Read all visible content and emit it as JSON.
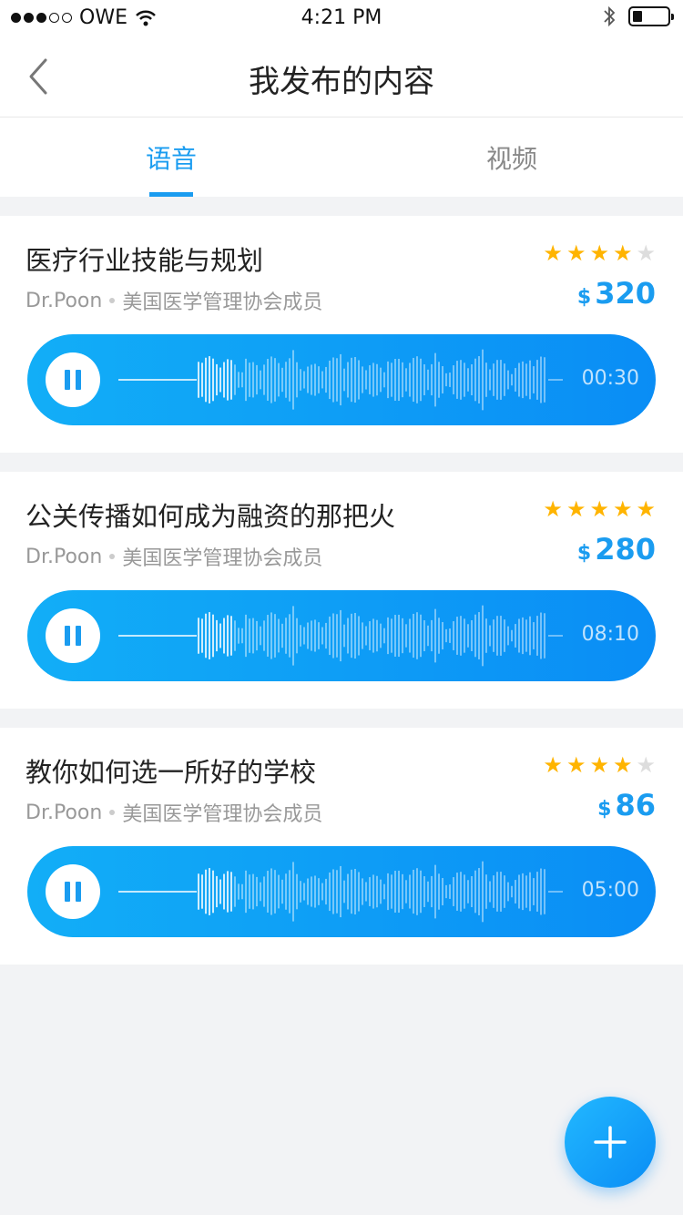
{
  "status_bar": {
    "carrier": "OWE",
    "time": "4:21 PM"
  },
  "header": {
    "title": "我发布的内容"
  },
  "tabs": [
    {
      "label": "语音",
      "active": true
    },
    {
      "label": "视频",
      "active": false
    }
  ],
  "items": [
    {
      "title": "医疗行业技能与规划",
      "author": "Dr.Poon",
      "org": "美国医学管理协会成员",
      "rating": 4,
      "max_rating": 5,
      "currency": "$",
      "price": "320",
      "duration": "00:30"
    },
    {
      "title": "公关传播如何成为融资的那把火",
      "author": "Dr.Poon",
      "org": "美国医学管理协会成员",
      "rating": 5,
      "max_rating": 5,
      "currency": "$",
      "price": "280",
      "duration": "08:10"
    },
    {
      "title": "教你如何选一所好的学校",
      "author": "Dr.Poon",
      "org": "美国医学管理协会成员",
      "rating": 4,
      "max_rating": 5,
      "currency": "$",
      "price": "86",
      "duration": "05:00"
    }
  ],
  "colors": {
    "accent": "#1a9cf0",
    "star": "#ffb400",
    "star_off": "#dddddd",
    "background": "#f2f3f5"
  },
  "icons": {
    "back": "chevron-left-icon",
    "pause": "pause-icon",
    "add": "plus-icon"
  }
}
